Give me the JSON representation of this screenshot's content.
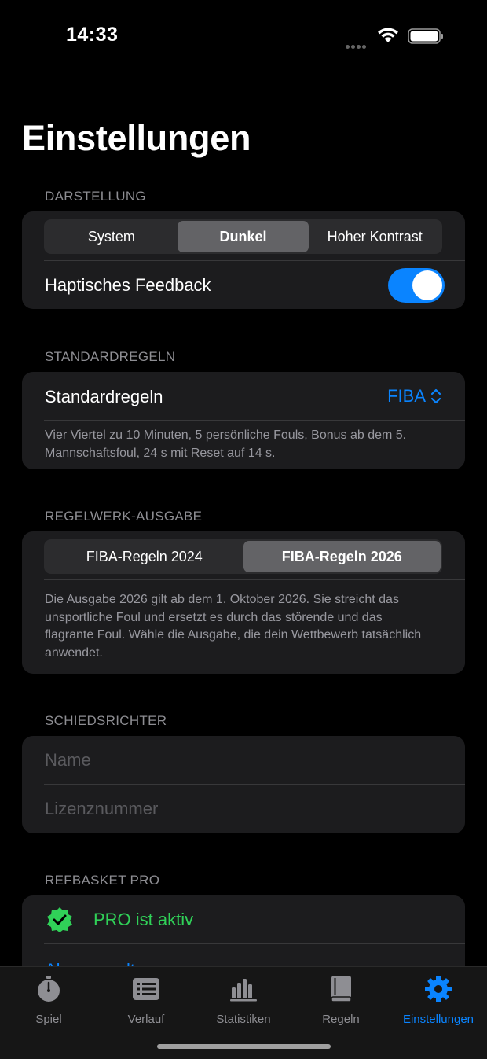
{
  "status": {
    "time": "14:33"
  },
  "page": {
    "title": "Einstellungen"
  },
  "darstellung": {
    "header": "DARSTELLUNG",
    "segments": [
      "System",
      "Dunkel",
      "Hoher Kontrast"
    ],
    "selected": "Dunkel",
    "haptic_label": "Haptisches Feedback",
    "haptic_on": true
  },
  "standardregeln": {
    "header": "STANDARDREGELN",
    "label": "Standardregeln",
    "value": "FIBA",
    "footnote": "Vier Viertel zu 10 Minuten, 5 persönliche Fouls, Bonus ab dem 5. Mannschaftsfoul, 24 s mit Reset auf 14 s."
  },
  "regelwerk": {
    "header": "REGELWERK-AUSGABE",
    "segments": [
      "FIBA-Regeln 2024",
      "FIBA-Regeln 2026"
    ],
    "selected": "FIBA-Regeln 2026",
    "footnote": "Die Ausgabe 2026 gilt ab dem 1. Oktober 2026. Sie streicht das unsportliche Foul und ersetzt es durch das störende und das flagrante Foul. Wähle die Ausgabe, die dein Wettbewerb tatsächlich anwendet."
  },
  "schiedsrichter": {
    "header": "SCHIEDSRICHTER",
    "name_placeholder": "Name",
    "license_placeholder": "Lizenznummer"
  },
  "pro": {
    "header": "REFBASKET PRO",
    "status": "PRO ist aktiv",
    "manage_link": "Abo verwalten"
  },
  "tabs": [
    {
      "label": "Spiel",
      "icon": "stopwatch-icon"
    },
    {
      "label": "Verlauf",
      "icon": "list-icon"
    },
    {
      "label": "Statistiken",
      "icon": "chart-icon"
    },
    {
      "label": "Regeln",
      "icon": "book-icon"
    },
    {
      "label": "Einstellungen",
      "icon": "gear-icon",
      "active": true
    }
  ],
  "colors": {
    "accent": "#0a84ff",
    "success": "#30d158",
    "card": "#1c1c1e"
  }
}
